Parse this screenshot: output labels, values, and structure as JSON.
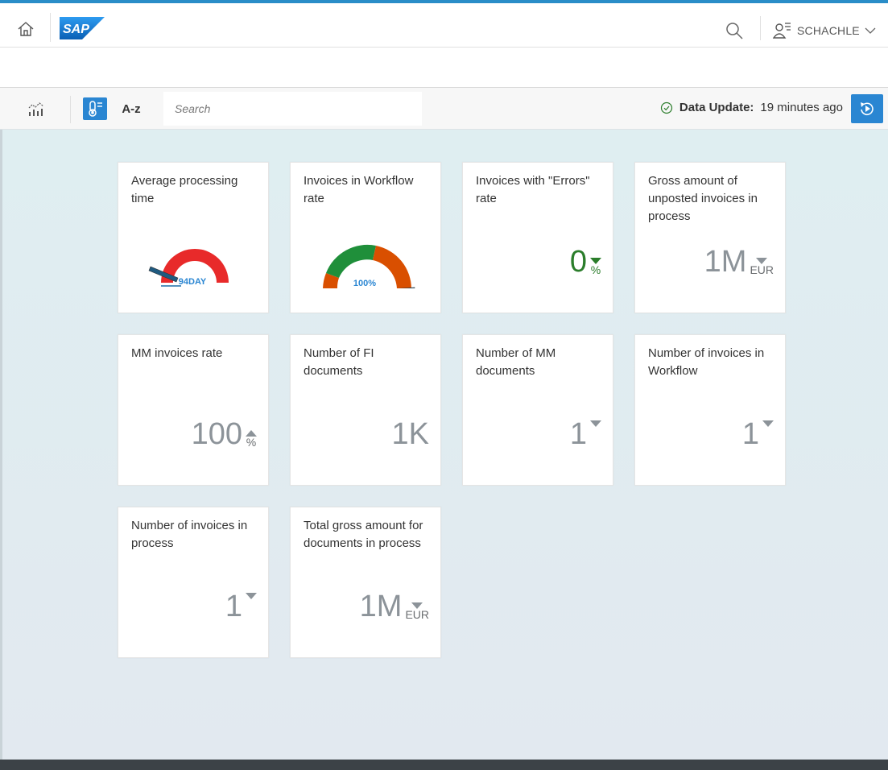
{
  "shell": {
    "logo_text": "SAP",
    "user_name": "SCHACHLE"
  },
  "toolbar": {
    "az_label": "A-z",
    "search_placeholder": "Search",
    "data_update_label": "Data Update:",
    "data_update_value": "19 minutes ago"
  },
  "tiles": [
    {
      "title": "Average processing time",
      "gauge_label": "94DAY",
      "gauge_fraction": 1.0,
      "gauge_color": "#e82a2a"
    },
    {
      "title": "Invoices in Workflow rate",
      "gauge_label": "100%",
      "gauge_fraction": 1.0
    },
    {
      "title": "Invoices with \"Errors\" rate",
      "value": "0",
      "unit": "%",
      "trend": "down",
      "status_color": "#2b7d2b"
    },
    {
      "title": "Gross amount of unposted invoices in process",
      "value": "1M",
      "unit": "EUR",
      "trend": "down"
    },
    {
      "title": "MM invoices rate",
      "value": "100",
      "unit": "%",
      "trend": "up"
    },
    {
      "title": "Number of FI documents",
      "value": "1K"
    },
    {
      "title": "Number of MM documents",
      "value": "1",
      "trend": "down"
    },
    {
      "title": "Number of invoices in Workflow",
      "value": "1",
      "trend": "down"
    },
    {
      "title": "Number of invoices in process",
      "value": "1",
      "trend": "down"
    },
    {
      "title": "Total gross amount for documents in process",
      "value": "1M",
      "unit": "EUR",
      "trend": "down"
    }
  ],
  "colors": {
    "accent": "#2a86d2",
    "gauge_red": "#e82a2a",
    "gauge_green": "#1f8f3a",
    "gauge_orange": "#d94f00",
    "positive": "#2b7d2b",
    "neutral": "#8c9399"
  },
  "icons": {
    "home": "home-icon",
    "search": "search-icon",
    "user": "user-icon",
    "chart": "chart-icon",
    "sort": "thermometer-sort-icon",
    "refresh": "refresh-icon",
    "check": "check-circle-icon"
  }
}
